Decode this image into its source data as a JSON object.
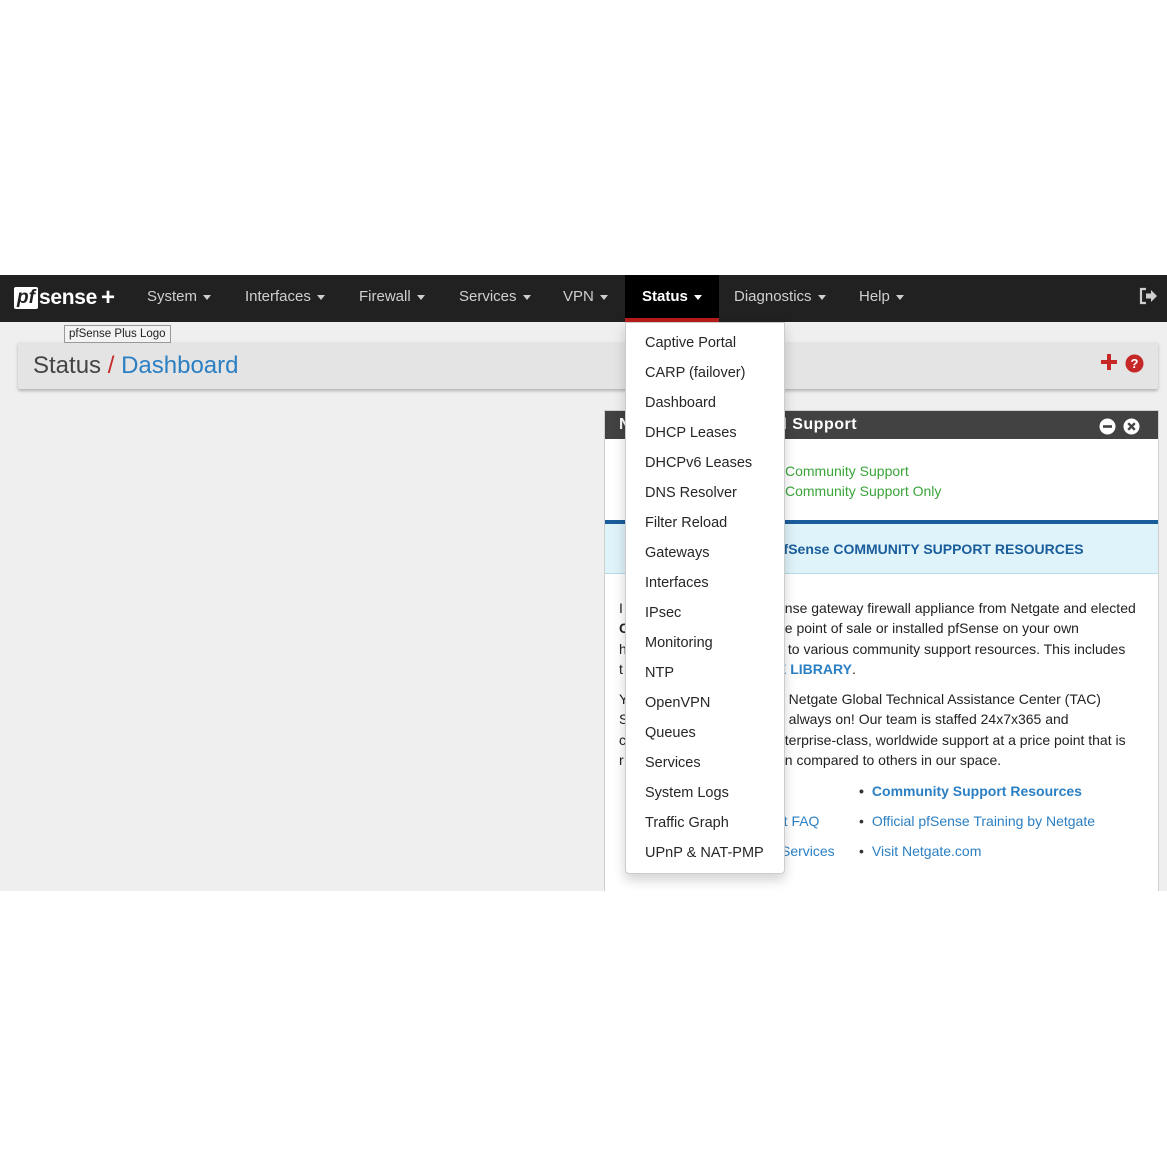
{
  "colors": {
    "navbar_bg": "#212121",
    "active_bar": "#b71c1c",
    "link_blue": "#2b7fc3",
    "support_green": "#3aa43a",
    "panel_header": "#424242"
  },
  "logo": {
    "pf": "pf",
    "sense": "sense",
    "plus": "+",
    "tooltip": "pfSense Plus Logo"
  },
  "nav": {
    "items": [
      {
        "label": "System"
      },
      {
        "label": "Interfaces"
      },
      {
        "label": "Firewall"
      },
      {
        "label": "Services"
      },
      {
        "label": "VPN"
      },
      {
        "label": "Status"
      },
      {
        "label": "Diagnostics"
      },
      {
        "label": "Help"
      }
    ],
    "active": "Status",
    "logout_icon": "sign-out-icon"
  },
  "breadcrumb": {
    "section": "Status",
    "separator": "/",
    "page": "Dashboard"
  },
  "status_menu": [
    "Captive Portal",
    "CARP (failover)",
    "Dashboard",
    "DHCP Leases",
    "DHCPv6 Leases",
    "DNS Resolver",
    "Filter Reload",
    "Gateways",
    "Interfaces",
    "IPsec",
    "Monitoring",
    "NTP",
    "OpenVPN",
    "Queues",
    "Services",
    "System Logs",
    "Traffic Graph",
    "UPnP & NAT-PMP"
  ],
  "widget": {
    "title_left": "N",
    "title_right": "d Support",
    "support_line1": "Community Support",
    "support_line2": "Community Support Only",
    "banner": "pfSense COMMUNITY SUPPORT RESOURCES",
    "para1": {
      "l1": "ense gateway firewall appliance from Netgate and elected",
      "l2": "ne point of sale or installed pfSense on your own",
      "l3": "s to various community support resources. This includes",
      "l4_link": "E LIBRARY",
      "l4_end": ".",
      "letters": [
        "I",
        "C",
        "h",
        "t"
      ]
    },
    "para2": {
      "l1": "a Netgate Global Technical Assistance Center (TAC)",
      "l2": "e always on! Our team is staffed 24x7x365 and",
      "l3": "nterprise-class, worldwide support at a price point that is",
      "l4": "en compared to others in our space.",
      "letters": [
        "Y",
        "S",
        "c",
        "r"
      ]
    },
    "links_left": [
      ":",
      "rt FAQ",
      "Services"
    ],
    "links_right": [
      "Community Support Resources",
      "Official pfSense Training by Netgate",
      "Visit Netgate.com"
    ]
  }
}
